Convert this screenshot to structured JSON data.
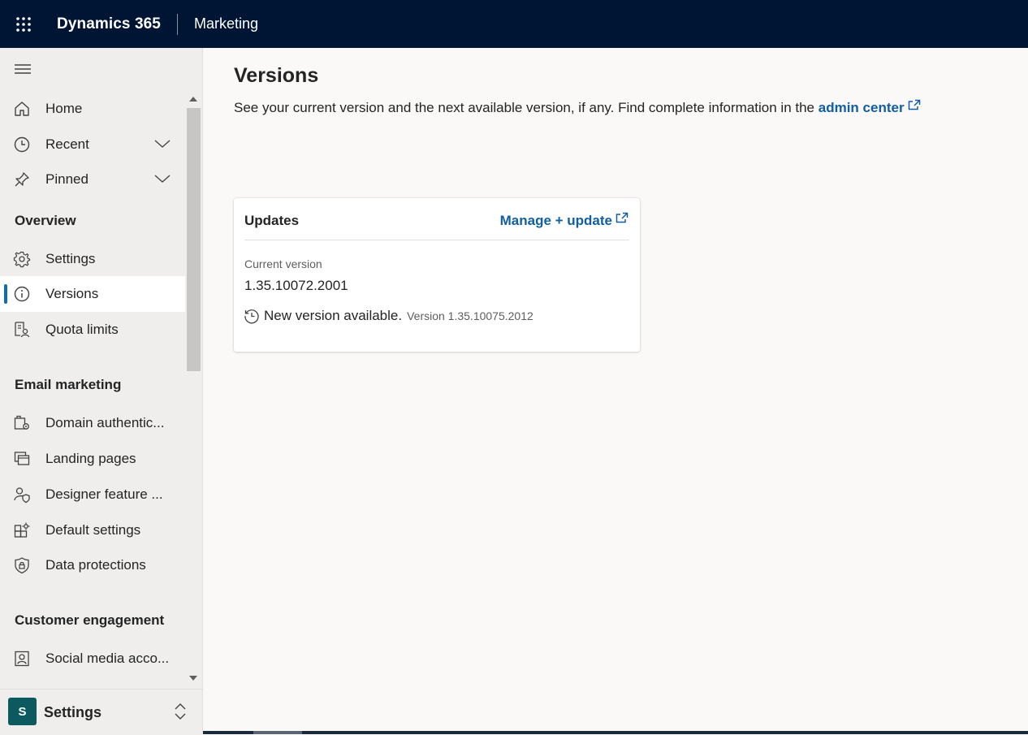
{
  "header": {
    "brand": "Dynamics 365",
    "app": "Marketing"
  },
  "sidebar": {
    "items": [
      {
        "label": "Home"
      },
      {
        "label": "Recent"
      },
      {
        "label": "Pinned"
      }
    ],
    "groups": [
      {
        "title": "Overview",
        "items": [
          {
            "label": "Settings"
          },
          {
            "label": "Versions"
          },
          {
            "label": "Quota limits"
          }
        ]
      },
      {
        "title": "Email marketing",
        "items": [
          {
            "label": "Domain authentic..."
          },
          {
            "label": "Landing pages"
          },
          {
            "label": "Designer feature ..."
          },
          {
            "label": "Default settings"
          },
          {
            "label": "Data protections"
          }
        ]
      },
      {
        "title": "Customer engagement",
        "items": [
          {
            "label": "Social media acco..."
          }
        ]
      }
    ],
    "area": {
      "badge": "S",
      "label": "Settings"
    }
  },
  "main": {
    "title": "Versions",
    "description": "See your current version and the next available version, if any. Find complete information in the",
    "admin_link": "admin center",
    "card": {
      "title": "Updates",
      "manage_link": "Manage + update",
      "current_label": "Current version",
      "current_value": "1.35.10072.2001",
      "new_text": "New version available.",
      "new_version": "Version 1.35.10075.2012"
    }
  },
  "colors": {
    "topbar": "#001534",
    "accent": "#0f6cbd",
    "link": "#115ea3",
    "area_badge": "#0b5a5f"
  }
}
